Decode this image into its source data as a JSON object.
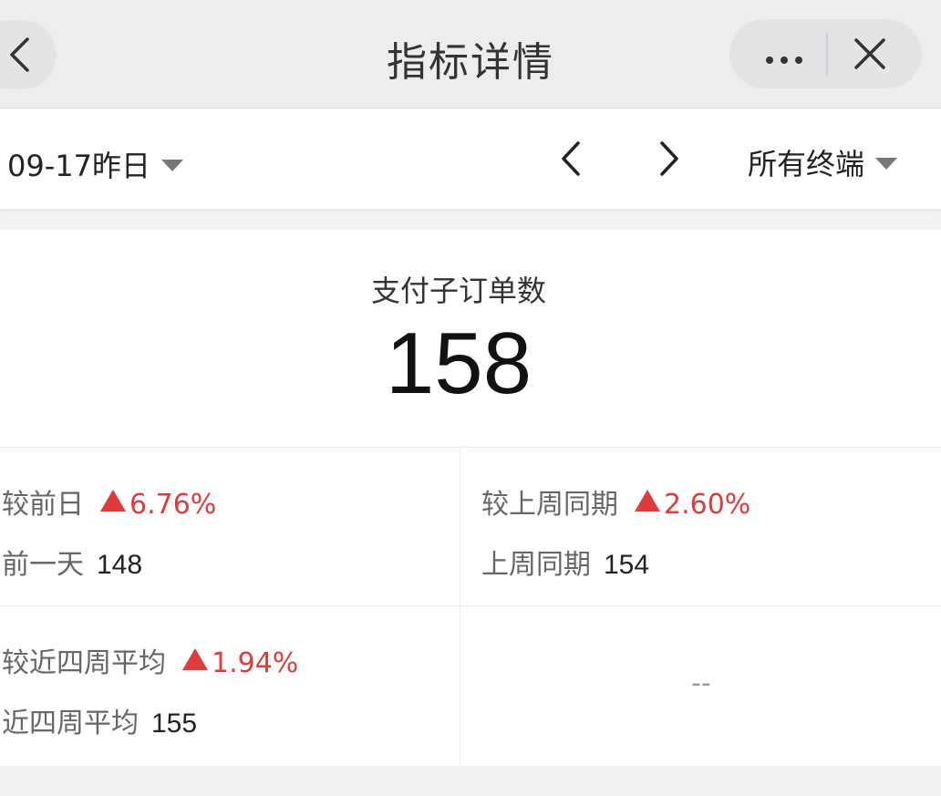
{
  "nav": {
    "title": "指标详情",
    "back_icon": "chevron-left-icon",
    "more_icon": "more-dots-icon",
    "close_icon": "close-icon"
  },
  "filter": {
    "date_label": "09-17昨日",
    "prev_icon": "chevron-left-icon",
    "next_icon": "chevron-right-icon",
    "terminal_label": "所有终端"
  },
  "metric": {
    "name": "支付子订单数",
    "value": "158"
  },
  "comparisons": [
    {
      "label": "较前日",
      "change": "6.76%",
      "base_label": "前一天",
      "base_value": "148"
    },
    {
      "label": "较上周同期",
      "change": "2.60%",
      "base_label": "上周同期",
      "base_value": "154"
    },
    {
      "label": "较近四周平均",
      "change": "1.94%",
      "base_label": "近四周平均",
      "base_value": "155"
    }
  ],
  "empty_cell": "--",
  "colors": {
    "up": "#e03c3c",
    "nav_bg": "#ededf0"
  }
}
